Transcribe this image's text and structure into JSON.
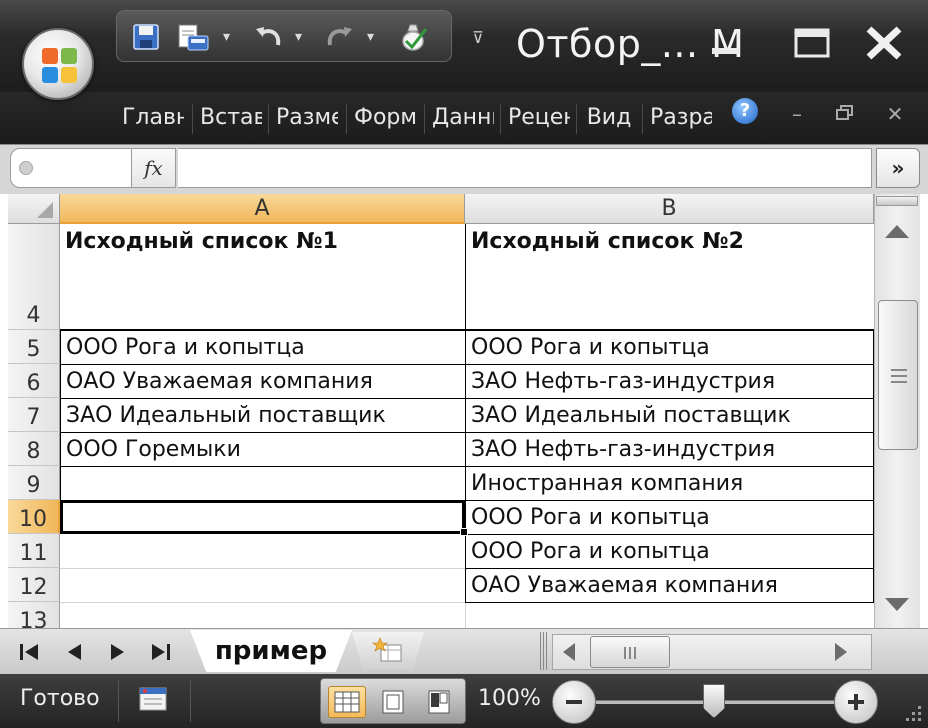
{
  "window": {
    "title": "Отбор_... M",
    "controls": {
      "minimize": "minimize",
      "maximize": "maximize",
      "close": "close"
    }
  },
  "ribbon": {
    "tabs": [
      "Главная",
      "Вставка",
      "Разметка страницы",
      "Формулы",
      "Данные",
      "Рецензирование",
      "Вид",
      "Разработчик"
    ],
    "help": "?"
  },
  "formula_bar": {
    "name_box": "",
    "fx_label": "fx",
    "formula": "",
    "expand": "»"
  },
  "sheet": {
    "columns": [
      "A",
      "B"
    ],
    "active_column": "A",
    "active_row": "10",
    "rows": [
      {
        "num": "4",
        "a": "Исходный список №1",
        "b": "Исходный список №2"
      },
      {
        "num": "5",
        "a": "ООО Рога и копытца",
        "b": "ООО Рога и копытца"
      },
      {
        "num": "6",
        "a": "ОАО Уважаемая компания",
        "b": "ЗАО Нефть-газ-индустрия"
      },
      {
        "num": "7",
        "a": "ЗАО Идеальный поставщик",
        "b": "ЗАО Идеальный поставщик"
      },
      {
        "num": "8",
        "a": "ООО Горемыки",
        "b": "ЗАО Нефть-газ-индустрия"
      },
      {
        "num": "9",
        "a": "",
        "b": "Иностранная компания"
      },
      {
        "num": "10",
        "a": "",
        "b": "ООО Рога и копытца"
      },
      {
        "num": "11",
        "a": "",
        "b": "ООО Рога и копытца"
      },
      {
        "num": "12",
        "a": "",
        "b": "ОАО Уважаемая компания"
      },
      {
        "num": "13",
        "a": "",
        "b": ""
      }
    ]
  },
  "tabs_bar": {
    "sheet_tabs": [
      "пример"
    ],
    "active_tab": "пример"
  },
  "status": {
    "text": "Готово",
    "zoom": "100%",
    "zoom_value": 100
  },
  "colors": {
    "accent_header": "#f1b75a",
    "title_bar": "#1d1d1d",
    "cell_border": "#000000"
  },
  "icons": [
    "office-button-icon",
    "save-icon",
    "print-preview-icon",
    "undo-icon",
    "redo-icon",
    "spell-check-icon",
    "help-icon",
    "macro-record-icon",
    "normal-view-icon",
    "page-layout-view-icon",
    "page-break-view-icon",
    "zoom-out-icon",
    "zoom-in-icon",
    "new-sheet-icon"
  ]
}
